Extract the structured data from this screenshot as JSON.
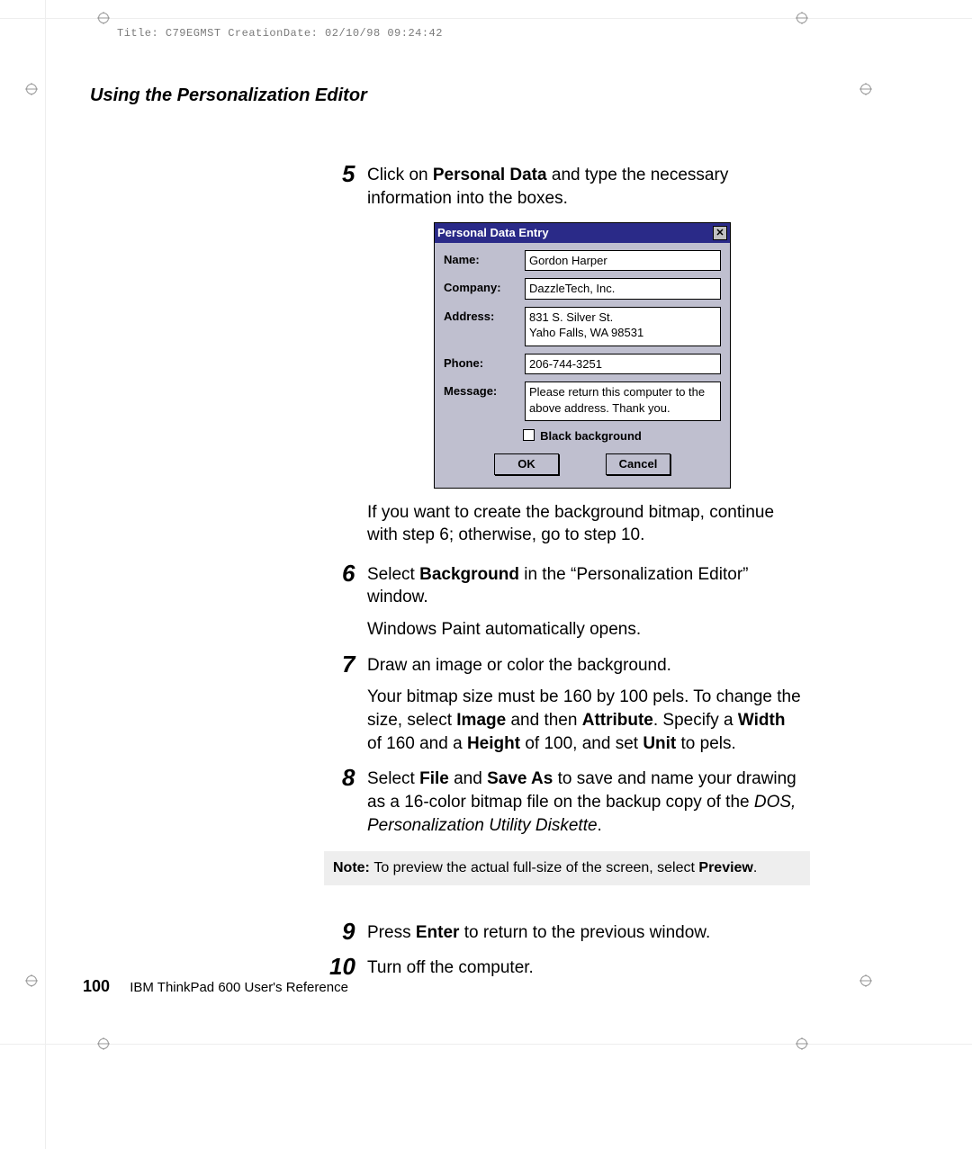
{
  "meta_header": "Title: C79EGMST CreationDate: 02/10/98 09:24:42",
  "section_heading": "Using the Personalization Editor",
  "step5": {
    "num": "5",
    "pre": " Click on ",
    "bold": "Personal Data",
    "post": " and type the necessary information into the boxes."
  },
  "dialog": {
    "title": "Personal Data Entry",
    "labels": {
      "name": "Name:",
      "company": "Company:",
      "address": "Address:",
      "phone": "Phone:",
      "message": "Message:"
    },
    "values": {
      "name": "Gordon Harper",
      "company": "DazzleTech, Inc.",
      "address": "831 S. Silver St.\nYaho Falls, WA 98531",
      "phone": "206-744-3251",
      "message": "Please return this computer to the above address.  Thank you."
    },
    "checkbox_label": "Black background",
    "ok": "OK",
    "cancel": "Cancel"
  },
  "after_dialog": "If you want to create the background bitmap, continue with step 6; otherwise, go to step 10.",
  "step6": {
    "num": "6",
    "pre": " Select ",
    "bold": "Background",
    "post": " in the “Personalization Editor” window.",
    "sub": "Windows Paint automatically opens."
  },
  "step7": {
    "num": "7",
    "text": " Draw an image or color the background.",
    "sub_pre": "Your bitmap size must be 160 by 100 pels.  To change the size, select ",
    "sub_b1": "Image",
    "sub_mid1": " and then ",
    "sub_b2": "Attribute",
    "sub_mid2": ".  Specify a ",
    "sub_b3": "Width",
    "sub_mid3": " of 160 and a ",
    "sub_b4": "Height",
    "sub_mid4": " of 100, and set ",
    "sub_b5": "Unit",
    "sub_end": " to pels."
  },
  "step8": {
    "num": "8",
    "pre": " Select ",
    "b1": "File",
    "mid1": " and ",
    "b2": "Save As",
    "post": " to save and name your drawing as a 16-color bitmap file on the backup copy of the ",
    "ital": "DOS, Personalization Utility Diskette",
    "end": "."
  },
  "note": {
    "label": "Note:  ",
    "pre": "To preview the actual full-size of the screen, select ",
    "bold": "Preview",
    "end": "."
  },
  "step9": {
    "num": "9",
    "pre": " Press ",
    "bold": "Enter",
    "post": " to return to the previous window."
  },
  "step10": {
    "num": "10",
    "text": " Turn off the computer."
  },
  "footer": {
    "page": "100",
    "text": "IBM ThinkPad 600 User's Reference"
  }
}
